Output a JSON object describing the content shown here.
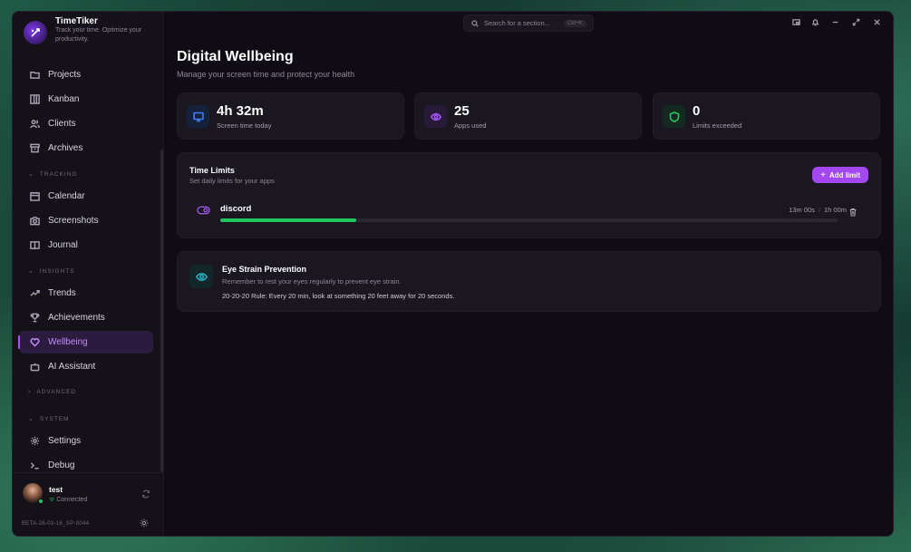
{
  "app": {
    "name": "TimeTiker",
    "tagline": "Track your time. Optimize your productivity."
  },
  "sidebar": {
    "items": [
      {
        "label": "Projects",
        "icon": "folder-icon"
      },
      {
        "label": "Kanban",
        "icon": "kanban-icon"
      },
      {
        "label": "Clients",
        "icon": "users-icon"
      },
      {
        "label": "Archives",
        "icon": "archive-icon"
      },
      {
        "label": "Calendar",
        "icon": "calendar-icon"
      },
      {
        "label": "Screenshots",
        "icon": "camera-icon"
      },
      {
        "label": "Journal",
        "icon": "book-icon"
      },
      {
        "label": "Trends",
        "icon": "trend-icon"
      },
      {
        "label": "Achievements",
        "icon": "trophy-icon"
      },
      {
        "label": "Wellbeing",
        "icon": "heart-icon",
        "active": true
      },
      {
        "label": "AI Assistant",
        "icon": "bot-icon"
      },
      {
        "label": "Settings",
        "icon": "gear-icon"
      },
      {
        "label": "Debug",
        "icon": "terminal-icon"
      }
    ],
    "sections": {
      "tracking": "TRACKING",
      "insights": "INSIGHTS",
      "advanced": "ADVANCED",
      "system": "SYSTEM"
    }
  },
  "user": {
    "name": "test",
    "status": "Connected",
    "build": "BETA-26-03-16_SP-0044"
  },
  "search": {
    "placeholder": "Search for a section...",
    "shortcut": "Ctrl+K"
  },
  "page": {
    "title": "Digital Wellbeing",
    "subtitle": "Manage your screen time and protect your health"
  },
  "stats": [
    {
      "value": "4h 32m",
      "label": "Screen time today",
      "icon": "monitor-icon",
      "color": "#3b82f6"
    },
    {
      "value": "25",
      "label": "Apps used",
      "icon": "eye-icon",
      "color": "#a855f7"
    },
    {
      "value": "0",
      "label": "Limits exceeded",
      "icon": "shield-icon",
      "color": "#22c55e"
    }
  ],
  "time_limits": {
    "title": "Time Limits",
    "subtitle": "Set daily limits for your apps",
    "add_label": "Add limit",
    "items": [
      {
        "app": "discord",
        "used": "13m 00s",
        "limit": "1h 00m",
        "progress": 0.22
      }
    ]
  },
  "eye_strain": {
    "title": "Eye Strain Prevention",
    "subtitle": "Remember to rest your eyes regularly to prevent eye strain.",
    "rule": "20-20-20 Rule: Every 20 min, look at something 20 feet away for 20 seconds."
  },
  "colors": {
    "accent": "#a347f0",
    "success": "#22c55e",
    "background": "#0f0c15"
  }
}
